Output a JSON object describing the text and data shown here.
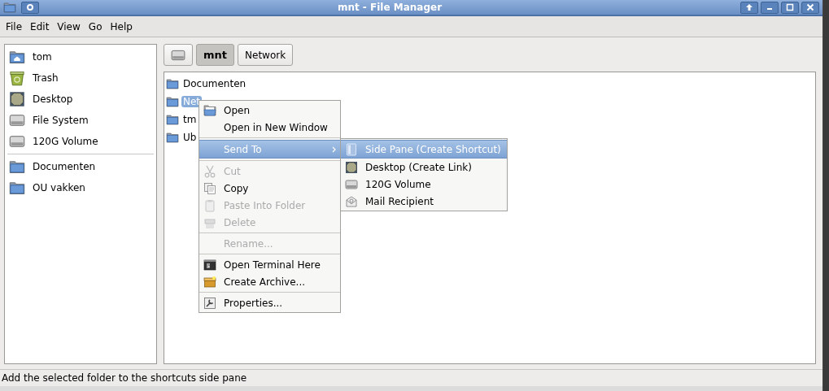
{
  "window": {
    "title": "mnt - File Manager"
  },
  "menu_bar": [
    "File",
    "Edit",
    "View",
    "Go",
    "Help"
  ],
  "sidebar": {
    "places": [
      {
        "label": "tom",
        "selected": false
      },
      {
        "label": "Trash",
        "selected": false
      },
      {
        "label": "Desktop",
        "selected": false
      },
      {
        "label": "File System",
        "selected": false
      },
      {
        "label": "120G Volume",
        "selected": false
      }
    ],
    "bookmarks": [
      {
        "label": "Documenten",
        "selected": false
      },
      {
        "label": "OU vakken",
        "selected": false
      }
    ]
  },
  "path_bar": [
    {
      "selected": false
    },
    {
      "label": "mnt",
      "selected": true
    },
    {
      "label": "Network",
      "selected": false
    }
  ],
  "files": [
    {
      "name": "Documenten",
      "selected": false
    },
    {
      "name": "Net",
      "selected": true
    },
    {
      "name": "tm",
      "selected": false
    },
    {
      "name": "Ub",
      "selected": false
    }
  ],
  "context_menu": [
    {
      "kind": "item",
      "label": "Open",
      "disabled": false,
      "selected": false,
      "submenu": false
    },
    {
      "kind": "item",
      "label": "Open in New Window",
      "disabled": false,
      "selected": false,
      "submenu": false
    },
    {
      "kind": "separator"
    },
    {
      "kind": "item",
      "label": "Send To",
      "disabled": false,
      "selected": true,
      "submenu": true
    },
    {
      "kind": "separator"
    },
    {
      "kind": "item",
      "label": "Cut",
      "disabled": true,
      "selected": false,
      "submenu": false
    },
    {
      "kind": "item",
      "label": "Copy",
      "disabled": false,
      "selected": false,
      "submenu": false
    },
    {
      "kind": "item",
      "label": "Paste Into Folder",
      "disabled": true,
      "selected": false,
      "submenu": false
    },
    {
      "kind": "item",
      "label": "Delete",
      "disabled": true,
      "selected": false,
      "submenu": false
    },
    {
      "kind": "separator"
    },
    {
      "kind": "item",
      "label": "Rename...",
      "disabled": true,
      "selected": false,
      "submenu": false
    },
    {
      "kind": "separator"
    },
    {
      "kind": "item",
      "label": "Open Terminal Here",
      "disabled": false,
      "selected": false,
      "submenu": false
    },
    {
      "kind": "item",
      "label": "Create Archive...",
      "disabled": false,
      "selected": false,
      "submenu": false
    },
    {
      "kind": "separator"
    },
    {
      "kind": "item",
      "label": "Properties...",
      "disabled": false,
      "selected": false,
      "submenu": false
    }
  ],
  "send_to_menu": [
    {
      "label": "Side Pane (Create Shortcut)",
      "selected": true
    },
    {
      "label": "Desktop (Create Link)",
      "selected": false
    },
    {
      "label": "120G Volume",
      "selected": false
    },
    {
      "label": "Mail Recipient",
      "selected": false
    }
  ],
  "status_bar": "Add the selected folder to the shortcuts side pane"
}
